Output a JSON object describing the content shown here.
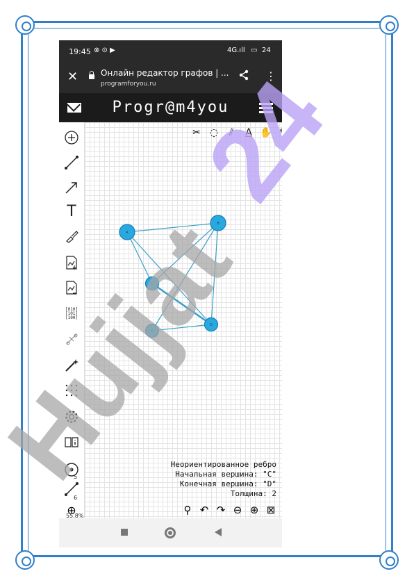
{
  "status": {
    "time": "19:45",
    "icons": "⊗ ⊙ ▶",
    "signal": "4G.ıll",
    "battery": "24"
  },
  "browser": {
    "close": "✕",
    "title": "Онлайн редактор графов | ...",
    "host": "programforyou.ru",
    "share": "share-icon",
    "more": "⋮"
  },
  "site": {
    "logo": "Progr@m4you"
  },
  "graph": {
    "vertices": [
      {
        "id": "a",
        "label": "A"
      },
      {
        "id": "b",
        "label": "B"
      },
      {
        "id": "c",
        "label": "C"
      },
      {
        "id": "d",
        "label": "D"
      },
      {
        "id": "e",
        "label": "E"
      }
    ],
    "edges": [
      [
        "a",
        "b"
      ],
      [
        "a",
        "d"
      ],
      [
        "a",
        "c"
      ],
      [
        "b",
        "c"
      ],
      [
        "b",
        "d"
      ],
      [
        "b",
        "e"
      ],
      [
        "c",
        "d"
      ],
      [
        "d",
        "e"
      ]
    ],
    "selected_edge": [
      "c",
      "d"
    ]
  },
  "info": {
    "line1": "Неориентированное ребро",
    "line2": "Начальная вершина: \"C\"",
    "line3": "Конечная вершина: \"D\"",
    "line4": "Толщина: 2"
  },
  "counters": {
    "vertices": "5",
    "edges": "6",
    "zoom": "55.8%"
  },
  "watermark": {
    "text1": "Hujjat",
    "text2": "24"
  },
  "colors": {
    "vertex": "#2aa9e0",
    "edge": "#3aa0c8",
    "watermark_gray": "#a7a7a7",
    "watermark_purple": "#b9a3f5"
  }
}
